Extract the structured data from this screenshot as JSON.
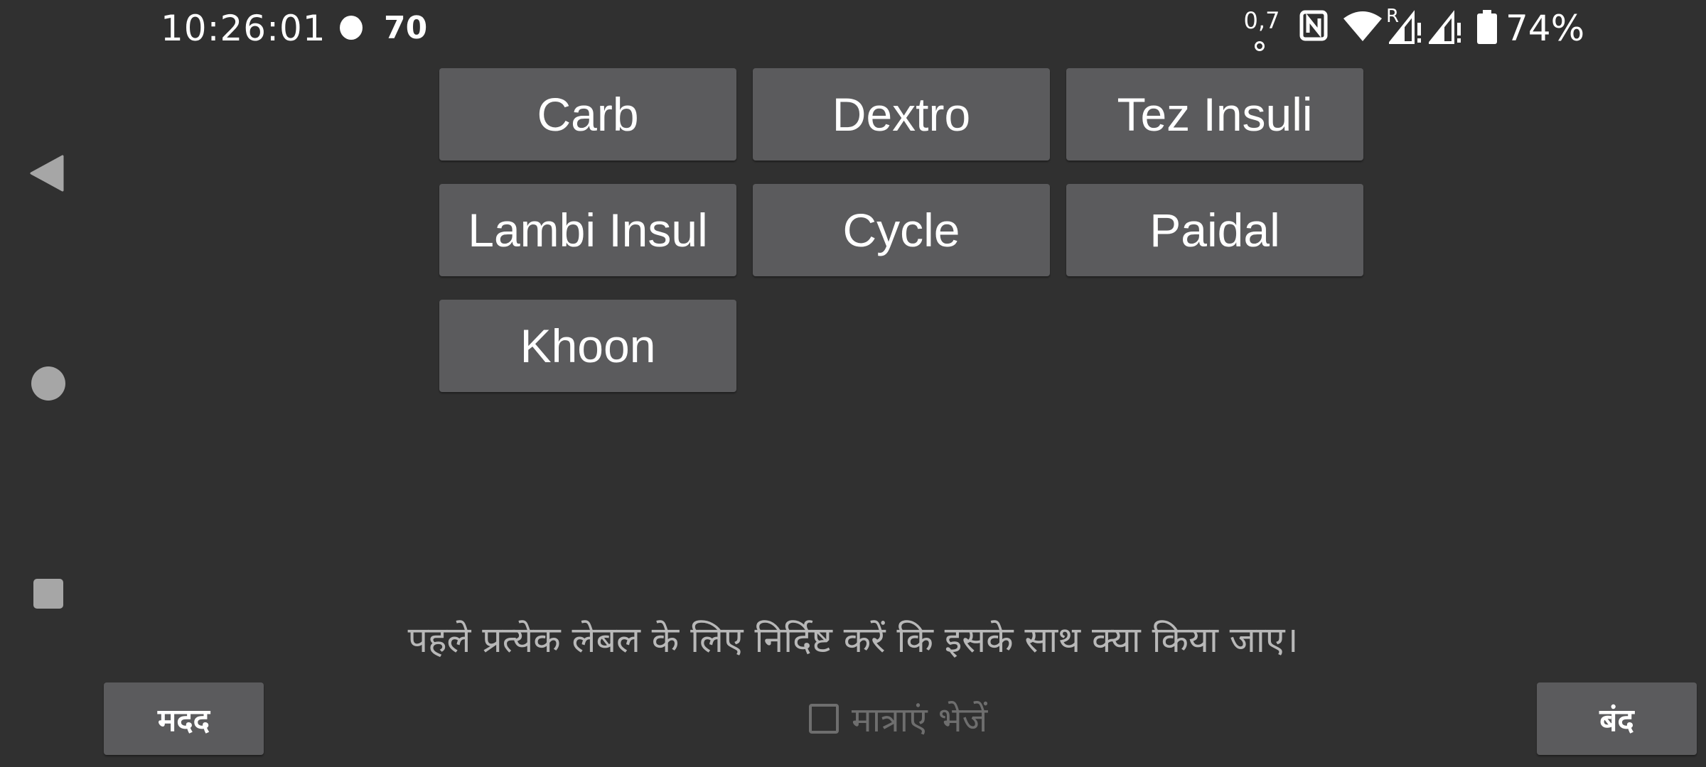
{
  "status_bar": {
    "time": "10:26:01",
    "notification_count": "70",
    "network_speed": "0,7",
    "roaming_indicator": "R",
    "battery_percent": "74%",
    "icons": [
      "dot-icon",
      "nfc-icon",
      "wifi-icon",
      "signal-roaming-icon",
      "signal-icon",
      "battery-icon"
    ]
  },
  "navigation": {
    "icons": [
      "back-icon",
      "home-icon",
      "recents-icon"
    ]
  },
  "label_buttons": [
    {
      "label": "Carb"
    },
    {
      "label": "Dextro"
    },
    {
      "label": "Tez Insuli"
    },
    {
      "label": "Lambi Insul"
    },
    {
      "label": "Cycle"
    },
    {
      "label": "Paidal"
    },
    {
      "label": "Khoon"
    }
  ],
  "instruction": "पहले प्रत्येक लेबल के लिए निर्दिष्ट करें कि इसके साथ क्या किया जाए।",
  "footer": {
    "help_label": "मदद",
    "send_amounts_label": "मात्राएं भेजें",
    "send_amounts_checked": false,
    "close_label": "बंद"
  },
  "colors": {
    "background": "#303030",
    "button": "#5b5b5d",
    "text": "#ffffff",
    "muted_text": "#b8b8b8",
    "disabled": "#6e6e6e"
  }
}
